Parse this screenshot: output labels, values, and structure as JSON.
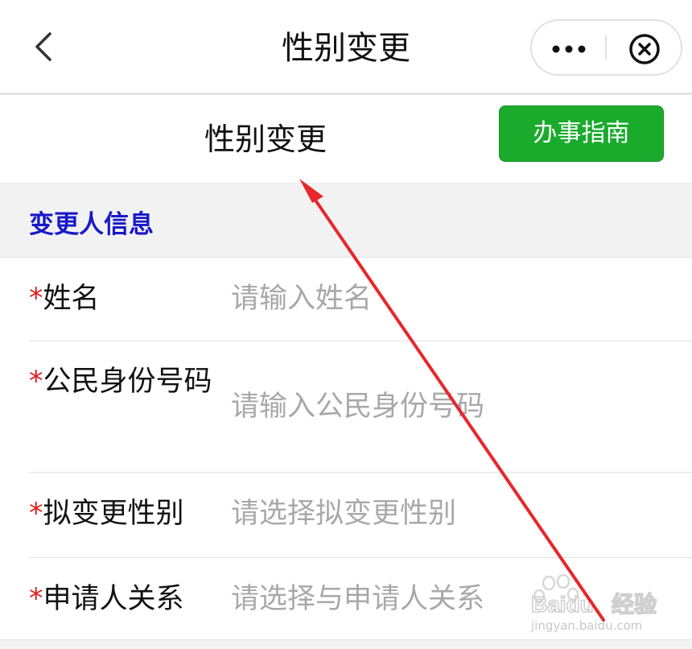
{
  "navbar": {
    "title": "性别变更",
    "back_icon": "chevron-left-icon",
    "more_icon": "more-dots-icon",
    "close_icon": "close-circle-icon"
  },
  "header": {
    "title": "性别变更",
    "guide_button_label": "办事指南",
    "guide_button_color": "#1aab2c"
  },
  "section": {
    "title": "变更人信息",
    "title_color": "#1818c8"
  },
  "form": {
    "required_mark": "*",
    "fields": [
      {
        "label": "姓名",
        "placeholder": "请输入姓名"
      },
      {
        "label": "公民身份号码",
        "placeholder": "请输入公民身份号码"
      },
      {
        "label": "拟变更性别",
        "placeholder": "请选择拟变更性别"
      },
      {
        "label": "申请人关系",
        "placeholder": "请选择与申请人关系"
      }
    ]
  },
  "watermark": {
    "brand": "Baidu",
    "brand_cn": "经验",
    "url": "jingyan.baidu.com"
  },
  "annotation": {
    "arrow_color": "#e8262b"
  }
}
